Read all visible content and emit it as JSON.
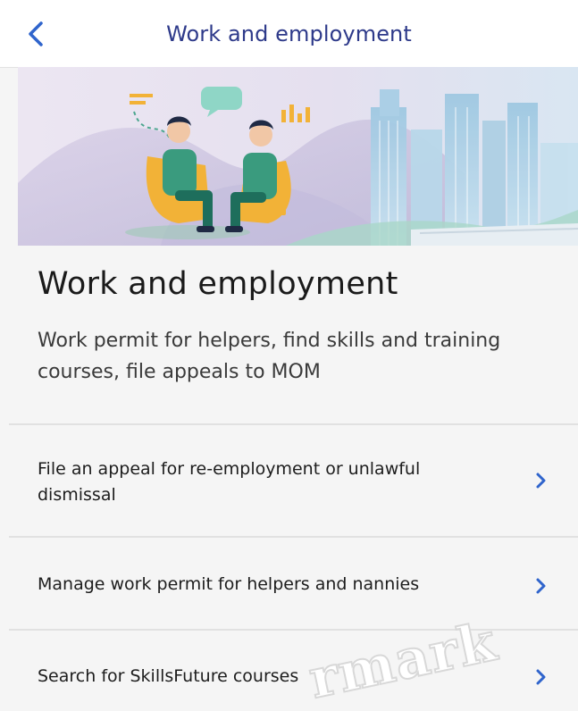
{
  "header": {
    "title": "Work and employment",
    "back_icon": "chevron-left-icon"
  },
  "colors": {
    "accent": "#2f64cc",
    "title": "#2e3a8a"
  },
  "hero_image": "people-chatting-city-skyline-illustration",
  "page": {
    "heading": "Work and employment",
    "description": "Work permit for helpers, find skills and training courses, file appeals to MOM"
  },
  "services": [
    {
      "label": "File an appeal for re-employment or unlawful dismissal",
      "icon": "chevron-right-icon"
    },
    {
      "label": "Manage work permit for helpers and nannies",
      "icon": "chevron-right-icon"
    },
    {
      "label": "Search for SkillsFuture courses",
      "icon": "chevron-right-icon"
    }
  ],
  "watermark": "rmark"
}
